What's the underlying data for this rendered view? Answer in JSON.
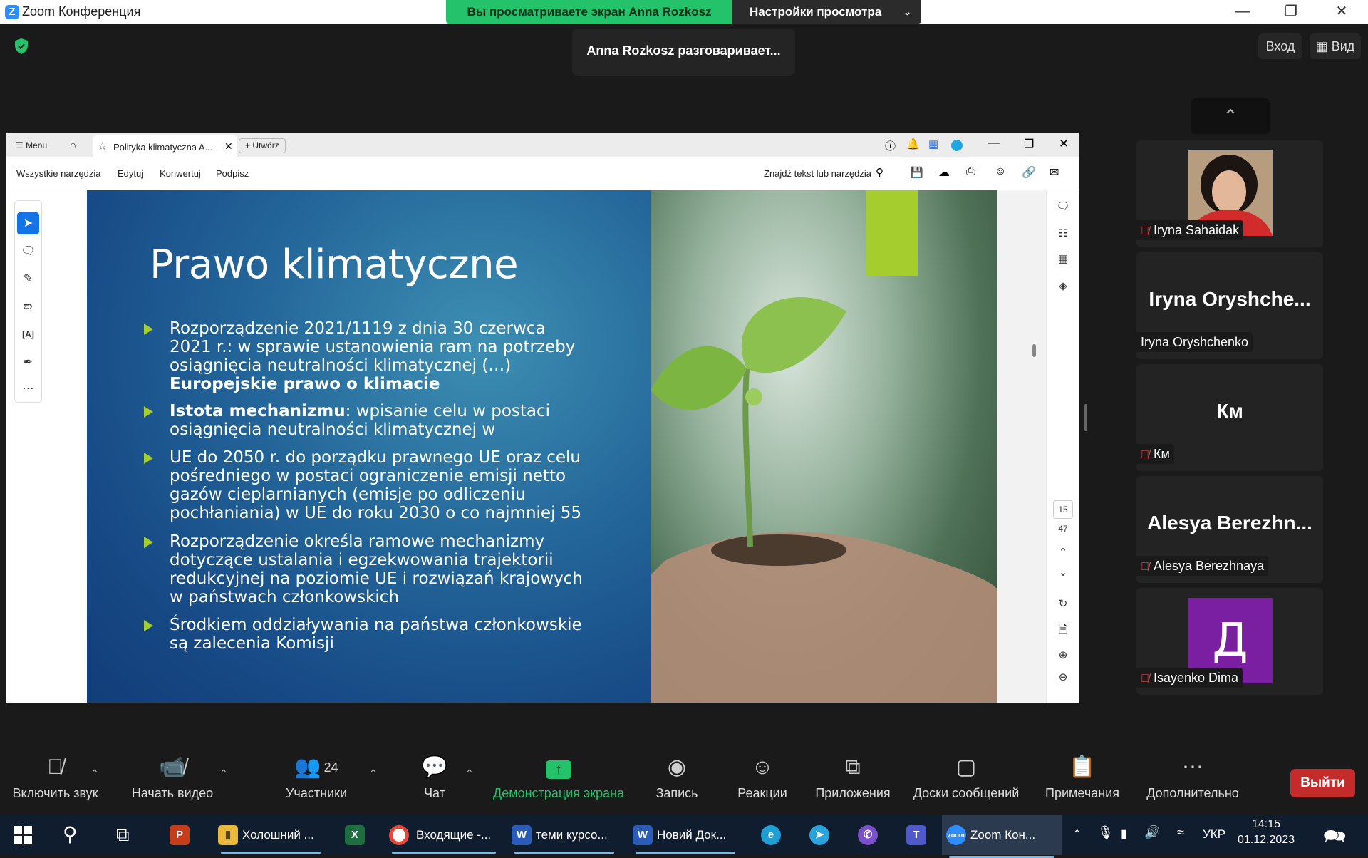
{
  "window": {
    "app_title": "Zoom Конференция",
    "share_banner": "Вы просматриваете экран Anna Rozkosz",
    "view_settings": "Настройки просмотра",
    "talking_notice": "Anna Rozkosz разговаривает...",
    "login_button": "Вход",
    "view_button": "Вид"
  },
  "acrobat": {
    "menu_label": "Menu",
    "tab_title": "Polityka klimatyczna A...",
    "create_label": "Utwórz",
    "toolbar": [
      "Wszystkie narzędzia",
      "Edytuj",
      "Konwertuj",
      "Podpisz"
    ],
    "search_label": "Znajdź tekst lub narzędzia",
    "page_current": "15",
    "page_total": "47"
  },
  "slide": {
    "title": "Prawo klimatyczne",
    "bullets": [
      {
        "text": "Rozporządzenie 2021/1119 z dnia 30 czerwca 2021 r.: w sprawie ustanowienia ram na potrzeby osiągnięcia neutralności klimatycznej (…)",
        "bold_tail": "Europejskie prawo o klimacie"
      },
      {
        "bold_head": "Istota mechanizmu",
        "text": ": wpisanie celu w postaci osiągnięcia neutralności klimatycznej w"
      },
      {
        "text": "UE do 2050 r. do porządku prawnego UE oraz celu pośredniego w postaci ograniczenie emisji netto gazów cieplarnianych (emisje po odliczeniu pochłaniania) w UE do roku 2030 o co najmniej 55"
      },
      {
        "text": "Rozporządzenie określa ramowe mechanizmy dotyczące ustalania i egzekwowania trajektorii redukcyjnej na poziomie UE i rozwiązań krajowych w państwach członkowskich"
      },
      {
        "text": "Środkiem oddziaływania na państwa członkowskie są zalecenia Komisji"
      }
    ]
  },
  "participants": [
    {
      "display": "",
      "name": "Iryna Sahaidak",
      "muted": true,
      "avatar": "photo"
    },
    {
      "display": "Iryna  Oryshche...",
      "name": "Iryna Oryshchenko",
      "muted": false
    },
    {
      "display": "Км",
      "name": "Км",
      "muted": true
    },
    {
      "display": "Alesya  Berezhn...",
      "name": "Alesya Berezhnaya",
      "muted": true
    },
    {
      "display": "Д",
      "name": "Isayenko Dima",
      "muted": true,
      "avatar": "letter",
      "avatar_color": "#7b1fa2"
    }
  ],
  "zoom_toolbar": {
    "unmute": "Включить звук",
    "start_video": "Начать видео",
    "participants": "Участники",
    "participants_count": "24",
    "chat": "Чат",
    "share_screen": "Демонстрация экрана",
    "record": "Запись",
    "reactions": "Реакции",
    "apps": "Приложения",
    "whiteboards": "Доски сообщений",
    "notes": "Примечания",
    "more": "Дополнительно",
    "leave": "Выйти"
  },
  "taskbar": {
    "apps": [
      "Холошний ...",
      "Входящие -...",
      "теми курсо...",
      "Новий Док...",
      "Zoom Кон..."
    ],
    "language": "УКР",
    "time": "14:15",
    "date": "01.12.2023"
  },
  "colors": {
    "share_green": "#23c26b",
    "leave_red": "#c42b2b",
    "slide_accent": "#a6cd2e",
    "zoom_blue": "#2d8cff"
  }
}
